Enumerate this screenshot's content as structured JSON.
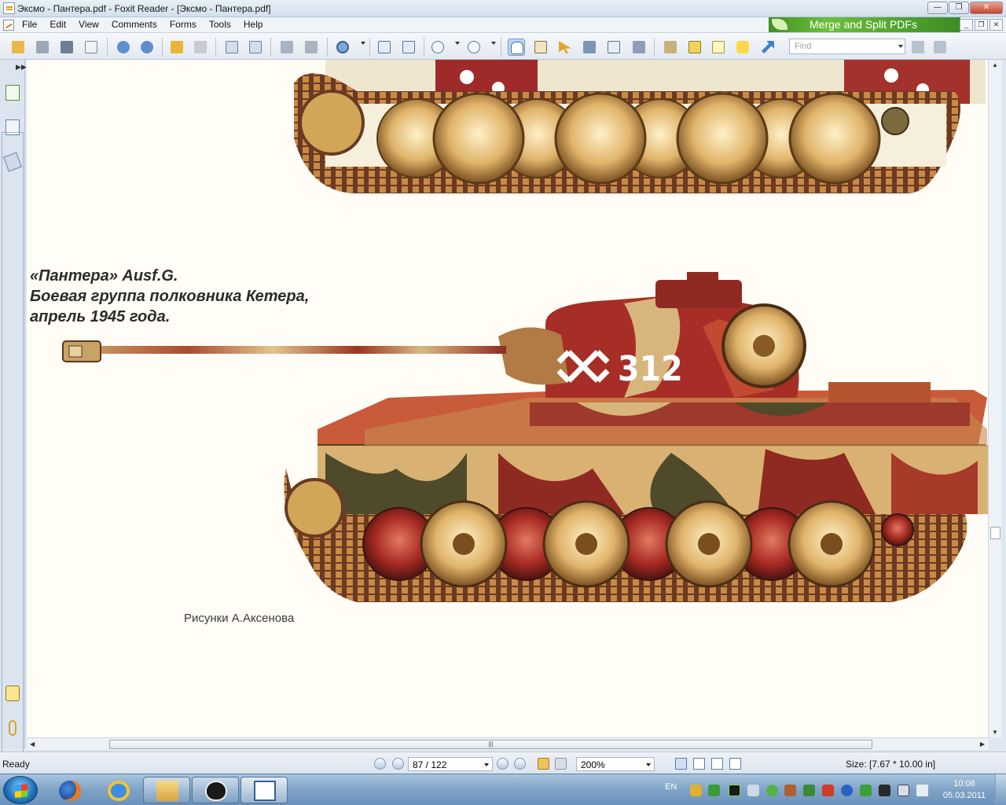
{
  "window": {
    "title": "Эксмо - Пантера.pdf - Foxit Reader - [Эксмо - Пантера.pdf]",
    "minimize_glyph": "—",
    "maximize_glyph": "❐",
    "close_glyph": "✕"
  },
  "menu": {
    "items": [
      "File",
      "Edit",
      "View",
      "Comments",
      "Forms",
      "Tools",
      "Help"
    ]
  },
  "banner": {
    "text": "Merge and Split PDFs"
  },
  "mdi": {
    "minimize_glyph": "_",
    "restore_glyph": "❐",
    "close_glyph": "✕"
  },
  "toolbar": {
    "find_placeholder": "Find"
  },
  "document": {
    "caption_line1": "«Пантера» Ausf.G.",
    "caption_line2": "Боевая группа полковника Кетера,",
    "caption_line3": "апрель 1945 года.",
    "turret_number": "312",
    "credit": "Рисунки А.Аксенова"
  },
  "status": {
    "ready": "Ready",
    "page": "87 / 122",
    "zoom": "200%",
    "size": "Size: [7.67 * 10.00 in]"
  },
  "taskbar": {
    "language": "EN",
    "time": "10:06",
    "date": "05.03.2011"
  },
  "colors": {
    "camo_red": "#8f2a22",
    "camo_tan": "#d9b273",
    "camo_green": "#4f4a2a",
    "accent_green": "#4e9f2d"
  }
}
